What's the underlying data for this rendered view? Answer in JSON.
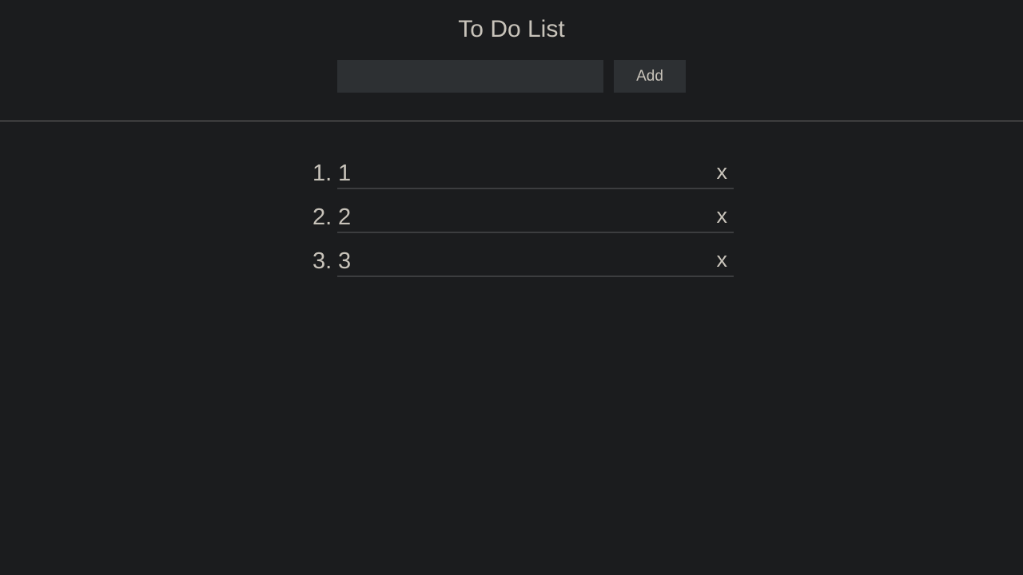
{
  "header": {
    "title": "To Do List",
    "input_value": "",
    "add_label": "Add"
  },
  "todos": [
    {
      "number": "1.",
      "text": "1",
      "delete_label": "x"
    },
    {
      "number": "2.",
      "text": "2",
      "delete_label": "x"
    },
    {
      "number": "3.",
      "text": "3",
      "delete_label": "x"
    }
  ],
  "colors": {
    "background": "#1b1c1e",
    "text": "#c8c3ba",
    "control_bg": "#2d3033",
    "divider": "#6a6a6a",
    "item_underline": "#3c3d3f"
  }
}
